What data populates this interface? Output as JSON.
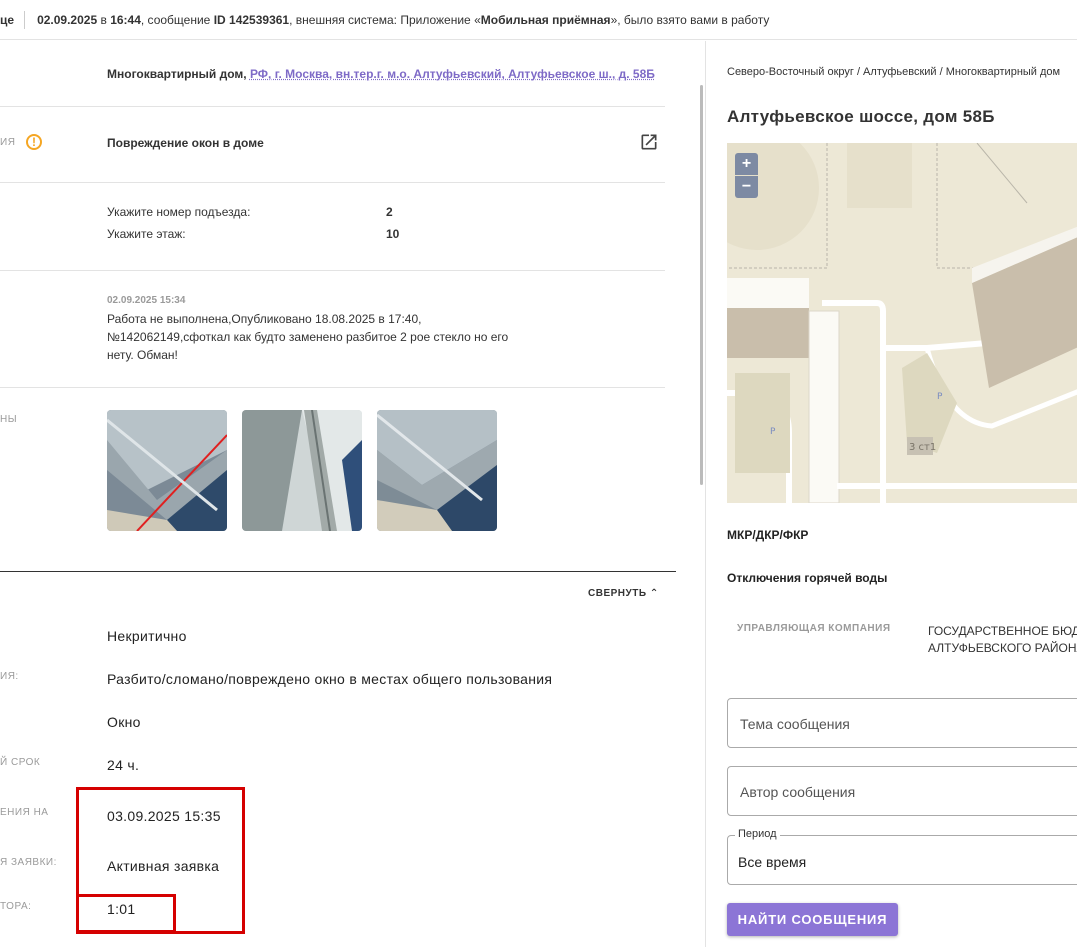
{
  "topbar": {
    "cut_label": "це",
    "date": "02.09.2025",
    "in_word": "в",
    "time": "16:44",
    "msg_prefix": ", сообщение",
    "id_label": "ID 142539361",
    "system_prefix": ", внешняя система: Приложение «",
    "system_name": "Мобильная приёмная",
    "suffix": "», было взято вами в работу"
  },
  "object": {
    "type": "Многоквартирный дом,",
    "address": "РФ, г. Москва, вн.тер.г. м.о. Алтуфьевский, Алтуфьевское ш., д. 58Б"
  },
  "category": {
    "label_cut": "ия",
    "title": "Повреждение окон в доме"
  },
  "questions": [
    {
      "q": "Укажите номер подъезда:",
      "a": "2"
    },
    {
      "q": "Укажите этаж:",
      "a": "10"
    }
  ],
  "comment": {
    "date": "02.09.2025 15:34",
    "text": "Работа не выполнена,Опубликовано 18.08.2025 в 17:40, №142062149,сфоткал как будто заменено разбитое 2 рое стекло но его нету. Обман!"
  },
  "photos": {
    "label_cut": "ны"
  },
  "collapse_label": "СВЕРНУТЬ",
  "details": [
    {
      "label_cut": "",
      "value": "Некритично"
    },
    {
      "label_cut": "ия:",
      "value": "Разбито/сломано/повреждено окно в местах общего пользования"
    },
    {
      "label_cut": "",
      "value": "Окно"
    },
    {
      "label_cut": "й срок",
      "value": "24 ч."
    },
    {
      "label_cut": "ения на",
      "value": "03.09.2025 15:35"
    },
    {
      "label_cut": "я заявки:",
      "value": "Активная заявка"
    },
    {
      "label_cut": "тора:",
      "value": "1:01"
    }
  ],
  "right": {
    "breadcrumb": "Северо-Восточный округ / Алтуфьевский / Многоквартирный дом",
    "address_title": "Алтуфьевское шоссе, дом 58Б",
    "map": {
      "zoom_in": "+",
      "zoom_out": "−",
      "parking1": "P",
      "parking2": "P",
      "building_label": "3 ст1"
    },
    "section1": "МКР/ДКР/ФКР",
    "section2": "Отключения горячей воды",
    "mc_label": "УПРАВЛЯЮЩАЯ КОМПАНИЯ",
    "mc_value_line1": "ГОСУДАРСТВЕННОЕ БЮДЖЕТНОЕ",
    "mc_value_line2": "АЛТУФЬЕВСКОГО РАЙОНА",
    "topic_placeholder": "Тема сообщения",
    "author_placeholder": "Автор сообщения",
    "period_legend": "Период",
    "period_value": "Все время",
    "find_button": "НАЙТИ СООБЩЕНИЯ"
  }
}
